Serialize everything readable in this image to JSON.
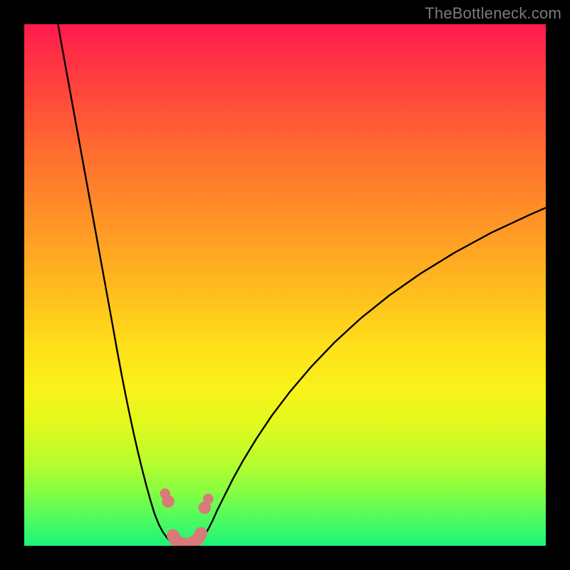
{
  "watermark": "TheBottleneck.com",
  "chart_data": {
    "type": "line",
    "title": "",
    "xlabel": "",
    "ylabel": "",
    "xlim": [
      0,
      100
    ],
    "ylim": [
      0,
      100
    ],
    "series": [
      {
        "name": "curve-left",
        "x": [
          6.5,
          7,
          8,
          9,
          10,
          11,
          12,
          13,
          14,
          15,
          16,
          17,
          17.8,
          18.6,
          19.4,
          20.2,
          21.0,
          21.8,
          22.6,
          23.4,
          24.2,
          25.0,
          25.8,
          26.6,
          27.4,
          28.2,
          29.0,
          29.4
        ],
        "y": [
          100,
          97,
          91.5,
          86,
          80.5,
          75,
          69.5,
          64,
          58.5,
          53,
          47.5,
          42,
          37.5,
          33.2,
          29.1,
          25.2,
          21.5,
          18.0,
          14.7,
          11.6,
          8.7,
          6.1,
          4.1,
          2.6,
          1.5,
          0.7,
          0.2,
          0.0
        ]
      },
      {
        "name": "curve-right",
        "x": [
          33.0,
          33.8,
          34.6,
          35.4,
          36.2,
          37.0,
          38.5,
          40.0,
          42.0,
          44.5,
          47.5,
          51.0,
          55.0,
          59.5,
          64.5,
          70.0,
          76.0,
          82.5,
          89.5,
          97.0,
          100.0
        ],
        "y": [
          0.0,
          0.8,
          2.0,
          3.4,
          5.0,
          6.8,
          9.8,
          12.8,
          16.4,
          20.5,
          25.0,
          29.6,
          34.3,
          39.0,
          43.6,
          48.0,
          52.2,
          56.2,
          60.0,
          63.5,
          64.8
        ]
      }
    ],
    "markers": [
      {
        "name": "marker-left-upper",
        "x": 27.0,
        "y": 10.0,
        "r": 1.0,
        "color": "#d97a78"
      },
      {
        "name": "marker-left-lower",
        "x": 27.6,
        "y": 8.5,
        "r": 1.2,
        "color": "#d97a78"
      },
      {
        "name": "marker-right-upper",
        "x": 35.3,
        "y": 9.0,
        "r": 1.0,
        "color": "#d97a78"
      },
      {
        "name": "marker-right-lower",
        "x": 34.6,
        "y": 7.3,
        "r": 1.2,
        "color": "#d97a78"
      }
    ],
    "bottom_band": {
      "name": "bottom-band",
      "points": [
        {
          "x": 28.5,
          "y": 2.0
        },
        {
          "x": 29.2,
          "y": 0.9
        },
        {
          "x": 30.2,
          "y": 0.4
        },
        {
          "x": 31.3,
          "y": 0.3
        },
        {
          "x": 32.4,
          "y": 0.6
        },
        {
          "x": 33.3,
          "y": 1.3
        },
        {
          "x": 33.9,
          "y": 2.4
        }
      ],
      "width": 2.4,
      "color": "#d97a78"
    },
    "background_gradient": {
      "top": "#ff1a4d",
      "mid": "#ffe01a",
      "bottom": "#1cf57a"
    }
  }
}
